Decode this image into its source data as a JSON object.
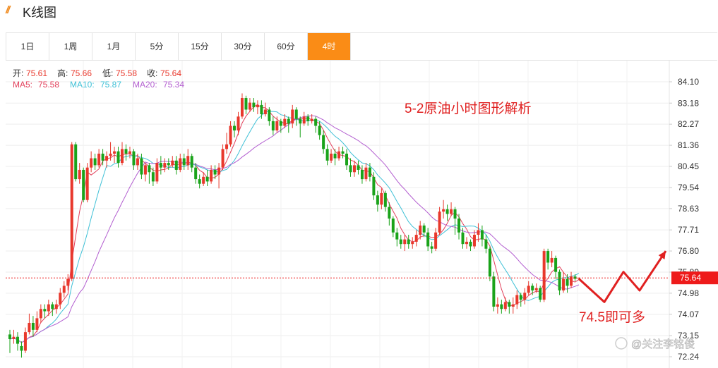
{
  "header": {
    "title": "K线图"
  },
  "tabs": [
    {
      "label": "1日"
    },
    {
      "label": "1周"
    },
    {
      "label": "1月"
    },
    {
      "label": "5分"
    },
    {
      "label": "15分"
    },
    {
      "label": "30分"
    },
    {
      "label": "60分"
    },
    {
      "label": "4时"
    }
  ],
  "active_tab": "4时",
  "stats": {
    "open_label": "开:",
    "open": "75.61",
    "high_label": "高:",
    "high": "75.66",
    "low_label": "低:",
    "low": "75.58",
    "close_label": "收:",
    "close": "75.64",
    "ma5_label": "MA5:",
    "ma5": "75.58",
    "ma10_label": "MA10:",
    "ma10": "75.87",
    "ma20_label": "MA20:",
    "ma20": "75.34"
  },
  "colors": {
    "up": "#e8382c",
    "down": "#1aa31a",
    "ma5": "#e2405b",
    "ma10": "#3ec0d6",
    "ma20": "#b35fd0",
    "annotation": "#e02020",
    "price_tag": "#ee1b1b",
    "active_tab": "#fa8c16"
  },
  "chart_data": {
    "type": "candlestick",
    "title": "5-2原油小时图形解析",
    "annotation": "74.5即可多",
    "watermark": "@关注李铭俊",
    "y_ticks": [
      "84.10",
      "83.18",
      "82.27",
      "81.36",
      "80.45",
      "79.54",
      "78.63",
      "77.71",
      "76.80",
      "75.89",
      "74.98",
      "74.07",
      "73.15",
      "72.24"
    ],
    "ylim": [
      72.24,
      84.1
    ],
    "current_price": "75.64",
    "candles": [
      [
        73.2,
        73.0,
        72.4,
        73.4
      ],
      [
        73.0,
        73.1,
        72.8,
        73.4
      ],
      [
        73.1,
        72.8,
        72.5,
        73.3
      ],
      [
        72.7,
        72.5,
        72.2,
        72.9
      ],
      [
        72.5,
        73.3,
        72.4,
        73.5
      ],
      [
        73.3,
        73.7,
        73.2,
        74.1
      ],
      [
        73.7,
        73.4,
        73.1,
        74.0
      ],
      [
        73.4,
        73.9,
        73.3,
        74.2
      ],
      [
        73.9,
        74.3,
        73.7,
        74.5
      ],
      [
        74.3,
        74.2,
        73.9,
        74.5
      ],
      [
        74.2,
        74.5,
        74.0,
        74.7
      ],
      [
        74.5,
        74.3,
        74.0,
        74.6
      ],
      [
        74.3,
        74.5,
        74.1,
        74.7
      ],
      [
        74.5,
        75.0,
        74.3,
        75.2
      ],
      [
        75.0,
        75.3,
        74.8,
        75.5
      ],
      [
        75.3,
        75.6,
        75.1,
        75.8
      ],
      [
        75.6,
        81.4,
        75.5,
        81.5
      ],
      [
        81.4,
        79.9,
        79.8,
        81.5
      ],
      [
        79.9,
        80.3,
        79.7,
        80.6
      ],
      [
        80.3,
        79.0,
        78.9,
        80.4
      ],
      [
        79.0,
        80.4,
        78.9,
        80.6
      ],
      [
        80.4,
        80.8,
        80.2,
        81.1
      ],
      [
        80.8,
        80.5,
        80.3,
        81.0
      ],
      [
        80.5,
        81.0,
        80.4,
        81.2
      ],
      [
        81.0,
        80.7,
        80.5,
        81.2
      ],
      [
        80.7,
        80.9,
        80.4,
        81.1
      ],
      [
        80.9,
        81.0,
        80.7,
        81.5
      ],
      [
        81.0,
        81.1,
        80.6,
        81.3
      ],
      [
        81.1,
        80.6,
        80.4,
        81.3
      ],
      [
        80.6,
        81.2,
        80.5,
        81.5
      ],
      [
        81.2,
        81.0,
        80.7,
        81.4
      ],
      [
        81.0,
        81.1,
        80.8,
        81.3
      ],
      [
        81.1,
        80.5,
        80.3,
        81.2
      ],
      [
        80.5,
        80.8,
        80.3,
        81.0
      ],
      [
        80.8,
        80.1,
        79.9,
        81.0
      ],
      [
        80.1,
        80.5,
        79.8,
        80.6
      ],
      [
        80.5,
        80.2,
        79.7,
        80.6
      ],
      [
        80.2,
        79.8,
        79.6,
        80.4
      ],
      [
        79.8,
        80.6,
        79.7,
        80.8
      ],
      [
        80.6,
        80.4,
        80.1,
        80.9
      ],
      [
        80.4,
        80.6,
        80.2,
        80.8
      ],
      [
        80.6,
        80.5,
        80.3,
        80.8
      ],
      [
        80.5,
        80.7,
        80.4,
        80.9
      ],
      [
        80.7,
        80.3,
        80.1,
        80.9
      ],
      [
        80.3,
        80.8,
        80.2,
        81.0
      ],
      [
        80.8,
        80.5,
        80.3,
        81.0
      ],
      [
        80.5,
        80.9,
        80.3,
        81.2
      ],
      [
        80.9,
        80.4,
        80.2,
        81.0
      ],
      [
        80.4,
        79.9,
        79.7,
        80.6
      ],
      [
        79.9,
        79.7,
        79.5,
        80.1
      ],
      [
        79.7,
        80.0,
        79.6,
        80.2
      ],
      [
        80.0,
        79.8,
        79.6,
        80.3
      ],
      [
        79.8,
        80.3,
        79.7,
        80.5
      ],
      [
        80.3,
        80.1,
        79.9,
        80.5
      ],
      [
        80.1,
        80.4,
        79.5,
        80.6
      ],
      [
        80.4,
        81.2,
        80.3,
        81.4
      ],
      [
        81.2,
        81.4,
        81.0,
        81.9
      ],
      [
        81.4,
        82.2,
        81.3,
        82.4
      ],
      [
        82.2,
        82.0,
        81.7,
        82.4
      ],
      [
        82.0,
        82.6,
        81.8,
        82.8
      ],
      [
        82.6,
        83.4,
        82.5,
        83.6
      ],
      [
        83.4,
        82.9,
        82.7,
        83.5
      ],
      [
        82.9,
        83.2,
        82.8,
        83.4
      ],
      [
        83.2,
        83.0,
        82.8,
        83.4
      ],
      [
        83.0,
        83.1,
        82.7,
        83.3
      ],
      [
        83.1,
        82.7,
        82.5,
        83.3
      ],
      [
        82.7,
        82.9,
        82.6,
        83.2
      ],
      [
        82.9,
        82.4,
        82.2,
        83.0
      ],
      [
        82.4,
        82.0,
        81.8,
        82.6
      ],
      [
        82.0,
        82.4,
        81.9,
        82.6
      ],
      [
        82.4,
        82.2,
        81.9,
        82.5
      ],
      [
        82.2,
        82.5,
        82.1,
        82.7
      ],
      [
        82.5,
        82.3,
        81.9,
        82.6
      ],
      [
        82.3,
        82.9,
        82.1,
        83.1
      ],
      [
        82.9,
        82.5,
        82.2,
        83.0
      ],
      [
        82.5,
        82.3,
        81.7,
        82.6
      ],
      [
        82.3,
        82.6,
        82.2,
        82.8
      ],
      [
        82.6,
        82.4,
        82.2,
        82.7
      ],
      [
        82.4,
        82.5,
        82.3,
        82.7
      ],
      [
        82.5,
        82.2,
        81.9,
        82.6
      ],
      [
        82.2,
        81.8,
        81.6,
        82.4
      ],
      [
        81.8,
        81.2,
        81.0,
        82.0
      ],
      [
        81.2,
        80.7,
        80.5,
        81.4
      ],
      [
        80.7,
        81.0,
        80.6,
        81.2
      ],
      [
        81.0,
        80.8,
        80.5,
        81.2
      ],
      [
        80.8,
        81.1,
        80.7,
        81.3
      ],
      [
        81.1,
        81.0,
        80.8,
        81.3
      ],
      [
        81.0,
        80.5,
        80.3,
        81.2
      ],
      [
        80.5,
        80.2,
        80.0,
        80.8
      ],
      [
        80.2,
        80.5,
        80.0,
        80.7
      ],
      [
        80.5,
        80.3,
        80.1,
        80.7
      ],
      [
        80.3,
        79.9,
        79.7,
        80.5
      ],
      [
        79.9,
        80.4,
        79.8,
        80.6
      ],
      [
        80.4,
        80.0,
        79.8,
        80.6
      ],
      [
        80.0,
        79.2,
        79.0,
        80.2
      ],
      [
        79.2,
        78.8,
        78.5,
        79.4
      ],
      [
        78.8,
        79.3,
        78.6,
        79.5
      ],
      [
        79.3,
        78.7,
        78.5,
        79.4
      ],
      [
        78.7,
        78.2,
        77.9,
        78.9
      ],
      [
        78.2,
        77.6,
        77.4,
        78.3
      ],
      [
        77.6,
        77.3,
        77.0,
        77.8
      ],
      [
        77.3,
        77.1,
        76.9,
        77.5
      ],
      [
        77.1,
        77.3,
        76.8,
        77.5
      ],
      [
        77.3,
        77.1,
        76.9,
        77.5
      ],
      [
        77.1,
        77.2,
        76.9,
        77.4
      ],
      [
        77.2,
        77.5,
        77.0,
        77.7
      ],
      [
        77.5,
        77.9,
        77.3,
        78.1
      ],
      [
        77.9,
        77.6,
        77.4,
        78.0
      ],
      [
        77.6,
        77.0,
        76.8,
        77.8
      ],
      [
        77.0,
        76.9,
        76.7,
        77.2
      ],
      [
        76.9,
        77.6,
        76.8,
        77.8
      ],
      [
        77.6,
        78.5,
        77.5,
        78.7
      ],
      [
        78.5,
        78.6,
        78.2,
        79.0
      ],
      [
        78.6,
        78.4,
        78.1,
        78.8
      ],
      [
        78.4,
        78.6,
        78.3,
        78.9
      ],
      [
        78.6,
        78.2,
        77.5,
        78.7
      ],
      [
        78.2,
        77.6,
        77.3,
        78.4
      ],
      [
        77.6,
        77.1,
        76.9,
        77.8
      ],
      [
        77.1,
        77.2,
        76.9,
        77.4
      ],
      [
        77.2,
        77.0,
        76.8,
        77.3
      ],
      [
        77.0,
        77.5,
        76.9,
        77.7
      ],
      [
        77.5,
        77.7,
        77.2,
        78.0
      ],
      [
        77.7,
        77.3,
        77.0,
        77.9
      ],
      [
        77.3,
        76.9,
        76.7,
        77.5
      ],
      [
        76.9,
        75.7,
        75.5,
        77.0
      ],
      [
        75.7,
        74.4,
        74.2,
        75.9
      ],
      [
        74.4,
        74.5,
        74.1,
        74.8
      ],
      [
        74.5,
        74.3,
        74.1,
        74.7
      ],
      [
        74.3,
        74.6,
        74.2,
        74.8
      ],
      [
        74.6,
        74.4,
        74.1,
        74.7
      ],
      [
        74.4,
        74.5,
        74.1,
        74.8
      ],
      [
        74.5,
        74.9,
        74.3,
        75.1
      ],
      [
        74.9,
        74.7,
        74.4,
        75.0
      ],
      [
        74.7,
        75.0,
        74.5,
        75.2
      ],
      [
        75.0,
        75.3,
        74.9,
        75.5
      ],
      [
        75.3,
        75.1,
        74.9,
        75.4
      ],
      [
        75.1,
        75.2,
        75.0,
        75.4
      ],
      [
        75.2,
        74.7,
        74.6,
        75.3
      ],
      [
        74.7,
        76.8,
        74.6,
        76.9
      ],
      [
        76.8,
        76.3,
        76.0,
        76.9
      ],
      [
        76.3,
        76.5,
        76.1,
        76.8
      ],
      [
        76.5,
        75.9,
        75.6,
        76.6
      ],
      [
        75.9,
        75.1,
        74.9,
        76.0
      ],
      [
        75.1,
        75.6,
        75.0,
        75.9
      ],
      [
        75.6,
        75.3,
        75.0,
        75.8
      ],
      [
        75.3,
        75.7,
        75.2,
        75.9
      ],
      [
        75.7,
        75.6,
        75.5,
        75.8
      ],
      [
        75.61,
        75.64,
        75.58,
        75.66
      ]
    ]
  }
}
